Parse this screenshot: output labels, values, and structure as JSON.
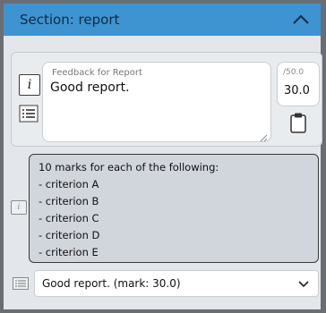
{
  "section": {
    "title": "Section: report"
  },
  "feedback": {
    "label": "Feedback for Report",
    "value": "Good report."
  },
  "mark": {
    "max_label": "/50.0",
    "value": "30.0"
  },
  "criteria": [
    "10 marks for each of the following:",
    "- criterion A",
    "- criterion B",
    "- criterion C",
    "- criterion D",
    "- criterion E"
  ],
  "comment_select": {
    "selected": "Good report. (mark: 30.0)"
  },
  "icons": {
    "collapse": "chevron-up-icon",
    "info": "info-icon",
    "list": "list-icon",
    "clipboard": "clipboard-icon",
    "resize": "resize-grip-icon",
    "dropdown": "chevron-down-icon"
  },
  "colors": {
    "header_bg": "#3e94d1",
    "frame_bg": "#6a6d72",
    "panel_bg": "#e3e6ea",
    "criteria_bg": "#d1d5dc"
  }
}
